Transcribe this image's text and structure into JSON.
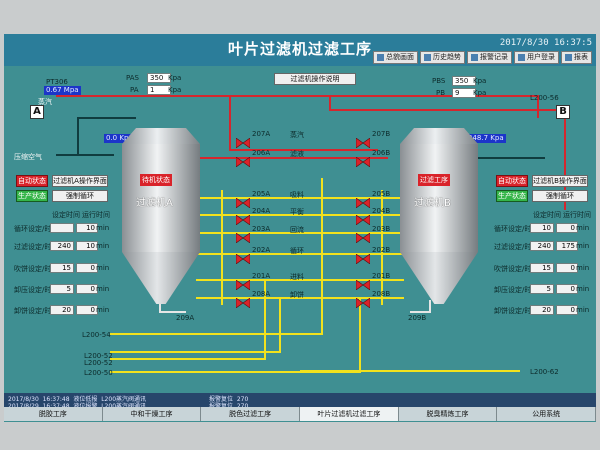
{
  "header": {
    "title": "叶片过滤机过滤工序",
    "datetime": "2017/8/30  16:37:5",
    "nav": [
      {
        "label": "总貌画面",
        "icon": "overview-icon"
      },
      {
        "label": "历史趋势",
        "icon": "trend-icon"
      },
      {
        "label": "报警记录",
        "icon": "alarm-icon"
      },
      {
        "label": "用户登录",
        "icon": "user-icon"
      },
      {
        "label": "报表",
        "icon": "report-icon"
      }
    ]
  },
  "ops_button": "过滤机操作说明",
  "steam": {
    "ps_label": "PT306",
    "pressure_value": "0.67 Mpa",
    "label": "蒸汽"
  },
  "pressure_left": {
    "pas_label": "PAS",
    "pas_value": "350",
    "pas_unit": "Kpa",
    "pa_label": "PA",
    "pa_value": "1",
    "pa_unit": "Kpa"
  },
  "pressure_right": {
    "pbs_label": "PBS",
    "pbs_value": "350",
    "pbs_unit": "Kpa",
    "pb_label": "PB",
    "pb_value": "9",
    "pb_unit": "Kpa"
  },
  "markers": {
    "a": "A",
    "b": "B"
  },
  "compressed_air": "压缩空气",
  "pressure_a": "0.0",
  "pressure_a_unit": "Kpa",
  "pressure_b": "248.7",
  "pressure_b_unit": "Kpa",
  "line_codes": {
    "top_right": "L200-56",
    "l54": "L200-54",
    "l52a": "L200-52",
    "l52b": "L200-52",
    "l50": "L200-50",
    "l62": "L200-62"
  },
  "filter_a": {
    "name": "过滤机A",
    "status": "待机状态",
    "mode_button": "自动状态",
    "ops_button": "过滤机A操作界面",
    "run_button": "生产状态",
    "cycle_button": "强制循环",
    "headers": [
      "设定时间",
      "运行时间"
    ],
    "rows": [
      {
        "label": "循环设定/时间",
        "set": "",
        "run": "10",
        "unit": "min"
      },
      {
        "label": "过滤设定/时间",
        "set": "240",
        "run": "10",
        "unit": "min"
      },
      {
        "label": "吹饼设定/时间",
        "set": "15",
        "run": "0",
        "unit": "min"
      },
      {
        "label": "卸压设定/时间",
        "set": "5",
        "run": "0",
        "unit": "min"
      },
      {
        "label": "卸饼设定/时间",
        "set": "20",
        "run": "0",
        "unit": "min"
      }
    ],
    "bottom_valve": "209A"
  },
  "filter_b": {
    "name": "过滤机B",
    "status": "过滤工序",
    "mode_button": "自动状态",
    "ops_button": "过滤机B操作界面",
    "run_button": "生产状态",
    "cycle_button": "强制循环",
    "headers": [
      "设定时间",
      "运行时间"
    ],
    "rows": [
      {
        "label": "循环设定/时间",
        "set": "10",
        "run": "0",
        "unit": "min"
      },
      {
        "label": "过滤设定/时间",
        "set": "240",
        "run": "175",
        "unit": "min"
      },
      {
        "label": "吹饼设定/时间",
        "set": "15",
        "run": "0",
        "unit": "min"
      },
      {
        "label": "卸压设定/时间",
        "set": "5",
        "run": "0",
        "unit": "min"
      },
      {
        "label": "卸饼设定/时间",
        "set": "20",
        "run": "0",
        "unit": "min"
      }
    ],
    "bottom_valve": "209B"
  },
  "valves_left": [
    "207A",
    "206A",
    "205A",
    "204A",
    "203A",
    "202A",
    "201A",
    "208A"
  ],
  "valves_right": [
    "207B",
    "206B",
    "205B",
    "204B",
    "203B",
    "202B",
    "201B",
    "208B"
  ],
  "pipe_labels": [
    "蒸汽",
    "滤液",
    "吸料",
    "平衡",
    "回流",
    "循环",
    "进料",
    "卸饼"
  ],
  "alarms": [
    {
      "time": "2017/8/30",
      "clock": "16:37:48",
      "desc": "液位低报",
      "code": "L200蒸汽阀通讯",
      "note": "报警复位",
      "count": "270"
    },
    {
      "time": "2017/8/29",
      "clock": "16:37:48",
      "desc": "液位报警",
      "code": "L200蒸汽阀通讯",
      "note": "报警复位",
      "count": "270"
    }
  ],
  "bottom_nav": [
    "脱胶工序",
    "中和干燥工序",
    "脱色过滤工序",
    "叶片过滤机过滤工序",
    "脱臭精炼工序",
    "公用系统"
  ]
}
